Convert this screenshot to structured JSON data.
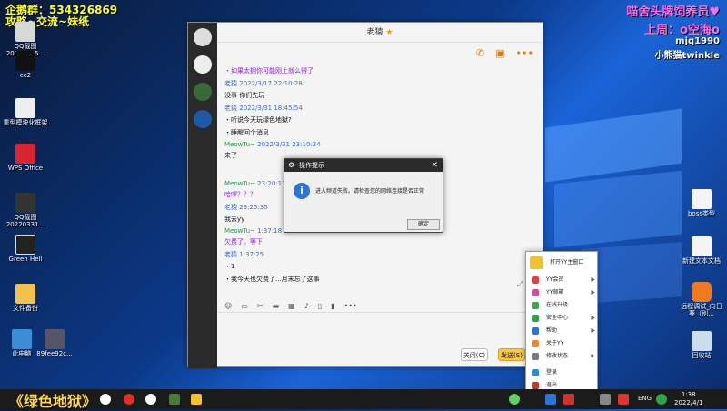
{
  "overlays": {
    "top_left_line1": "企鹅群：534326869",
    "top_left_line2": "攻略~交流~妹纸",
    "top_right_line1": "喵舍头牌饲养员♥",
    "top_right_line2": "上周：o空海o",
    "top_right_line3": "mjq1990",
    "top_right_line4": "小熊猫twinkle",
    "bottom_left": "《绿色地狱》"
  },
  "desktop_left": [
    {
      "label": "QQ截图\n20220325..."
    },
    {
      "label": "cc2"
    },
    {
      "label": "重型模块化框架"
    },
    {
      "label": "WPS Office"
    },
    {
      "label": "QQ截图\n20220331..."
    },
    {
      "label": "Green Hell"
    },
    {
      "label": "文件备份"
    },
    {
      "label": "此电脑"
    },
    {
      "label": "89fee92c..."
    }
  ],
  "desktop_right": [
    {
      "label": "boss类型"
    },
    {
      "label": "新建文本文档"
    },
    {
      "label": "远程调试_向日葵（别..."
    },
    {
      "label": "回收站"
    }
  ],
  "chat": {
    "title": "老猿",
    "toolbar_icons": [
      "phone-icon",
      "video-icon",
      "more-icon"
    ],
    "messages": [
      {
        "name": "",
        "time": "",
        "text": "・如果太拥你可能刚上就么得了",
        "purple": true
      },
      {
        "name": "老猿",
        "time": "2022/3/17 22:10:28",
        "text": "没事 你们先玩"
      },
      {
        "name": "老猿",
        "time": "2022/3/31 18:45:54",
        "text": "・听说今天玩绿色地狱?"
      },
      {
        "name": "",
        "time": "",
        "text": "・睡醒回个消息"
      },
      {
        "name": "MeowTu~",
        "time": "2022/3/31 23:10:24",
        "text": "来了",
        "green": true
      },
      {
        "name": "MeowTu~",
        "time": "23:20:17",
        "text": "哈啰？？？",
        "green": true,
        "purple": true
      },
      {
        "name": "老猿",
        "time": "23:25:35",
        "text": "我去yy"
      },
      {
        "name": "MeowTu~",
        "time": "1:37:18",
        "text": "欠费了。等下",
        "green": true,
        "purple": true
      },
      {
        "name": "老猿",
        "time": "1:37:25",
        "text": "・1"
      },
      {
        "name": "",
        "time": "",
        "text": "・我今天也欠费了...月末忘了这事"
      }
    ],
    "close_label": "关闭(C)",
    "send_label": "发送(S)"
  },
  "dialog": {
    "title": "操作提示",
    "message": "进入频道失败。请检查您的网络连接是否正常",
    "ok_label": "确定"
  },
  "tray_menu": {
    "items": [
      {
        "label": "打开YY主窗口",
        "color": "#f3c030",
        "arrow": false
      },
      {
        "label": "YY会员",
        "color": "#e0453a",
        "arrow": true
      },
      {
        "label": "YY邮箱",
        "color": "#d94b9a",
        "arrow": true
      },
      {
        "label": "在线升级",
        "color": "#3ea64a",
        "arrow": false
      },
      {
        "label": "安全中心",
        "color": "#2e9e4f",
        "arrow": true
      },
      {
        "label": "帮助",
        "color": "#2d73d8",
        "arrow": true
      },
      {
        "label": "关于YY",
        "color": "#e8882a",
        "arrow": false
      },
      {
        "label": "修改状态",
        "color": "#7a7a7a",
        "arrow": true
      },
      {
        "label": "登录",
        "color": "#2d8ad8",
        "arrow": false
      },
      {
        "label": "退出",
        "color": "#c0392b",
        "arrow": false
      }
    ]
  },
  "taskbar": {
    "lang": "ENG",
    "time": "1:38",
    "date": "2022/4/1"
  }
}
